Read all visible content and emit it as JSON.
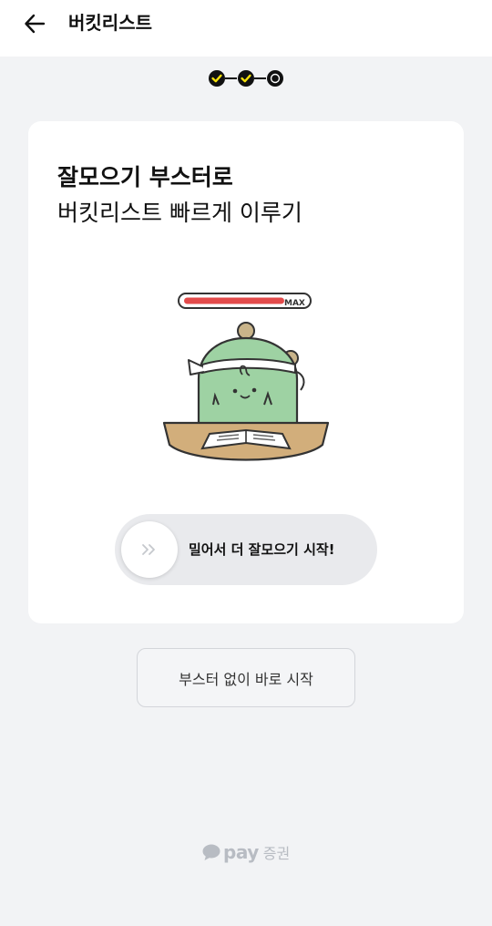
{
  "header": {
    "title": "버킷리스트",
    "back_icon": "arrow-left-icon"
  },
  "stepper": {
    "total_steps": 3,
    "current_step": 3,
    "completed_color": "#f5e10a",
    "active_color": "#111111"
  },
  "card": {
    "title_line1": "잘모으기 부스터로",
    "title_line2": "버킷리스트 빠르게 이루기",
    "illustration": {
      "gauge_label": "MAX",
      "gauge_level": 1.0,
      "gauge_color": "#e34b4b",
      "character_color": "#9ed2a3"
    },
    "slider": {
      "label": "밀어서 더 잘모으기 시작!",
      "knob_icon": "double-chevron-right-icon",
      "progress": 0
    }
  },
  "skip_button": {
    "label": "부스터 없이 바로 시작"
  },
  "footer": {
    "logo_icon": "speech-bubble-icon",
    "brand": "pay",
    "suffix": "증권"
  }
}
